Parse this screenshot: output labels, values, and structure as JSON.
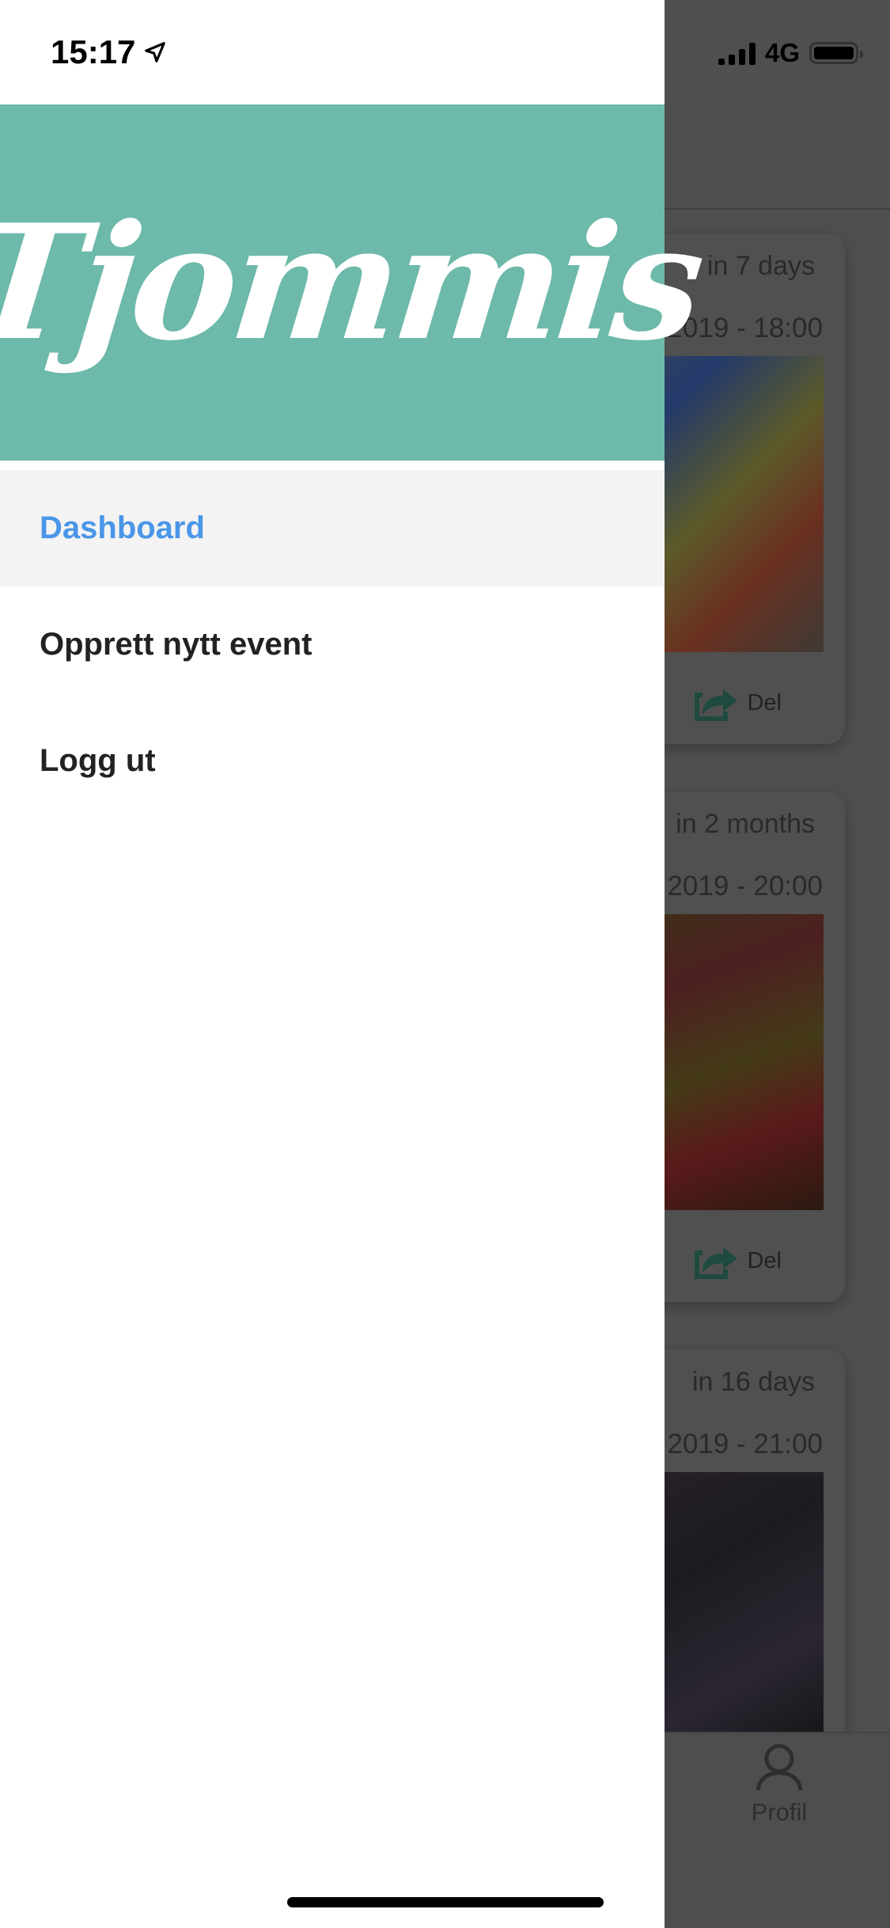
{
  "status_bar": {
    "time": "15:17",
    "network": "4G"
  },
  "drawer": {
    "logo": "Tjommis",
    "menu": [
      {
        "label": "Dashboard",
        "active": true
      },
      {
        "label": "Opprett nytt event",
        "active": false
      },
      {
        "label": "Logg ut",
        "active": false
      }
    ]
  },
  "background": {
    "events": [
      {
        "relative": "in 7 days",
        "date": "2019 - 18:00",
        "share": "Del"
      },
      {
        "relative": "in 2 months",
        "date": "2019 - 20:00",
        "share": "Del"
      },
      {
        "relative": "in 16 days",
        "date": "2019 - 21:00"
      }
    ],
    "tab_bar": {
      "profile": "Profil"
    }
  },
  "colors": {
    "brand": "#6db9aa",
    "active": "#4a96e8",
    "overlay": "#4f4f4f"
  }
}
